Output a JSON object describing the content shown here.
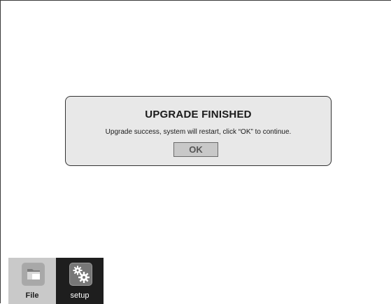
{
  "dialog": {
    "title": "UPGRADE FINISHED",
    "message": "Upgrade success, system will restart, click “OK” to continue.",
    "ok_label": "OK"
  },
  "taskbar": {
    "items": [
      {
        "label": "File",
        "icon": "folder-icon"
      },
      {
        "label": "setup",
        "icon": "gears-icon"
      }
    ]
  },
  "colors": {
    "background": "#ffffff",
    "dialog_background": "#e8e8e8",
    "button_background": "#c8c8c8",
    "file_tile": "#c9c9c9",
    "setup_tile": "#1e1e1e"
  }
}
